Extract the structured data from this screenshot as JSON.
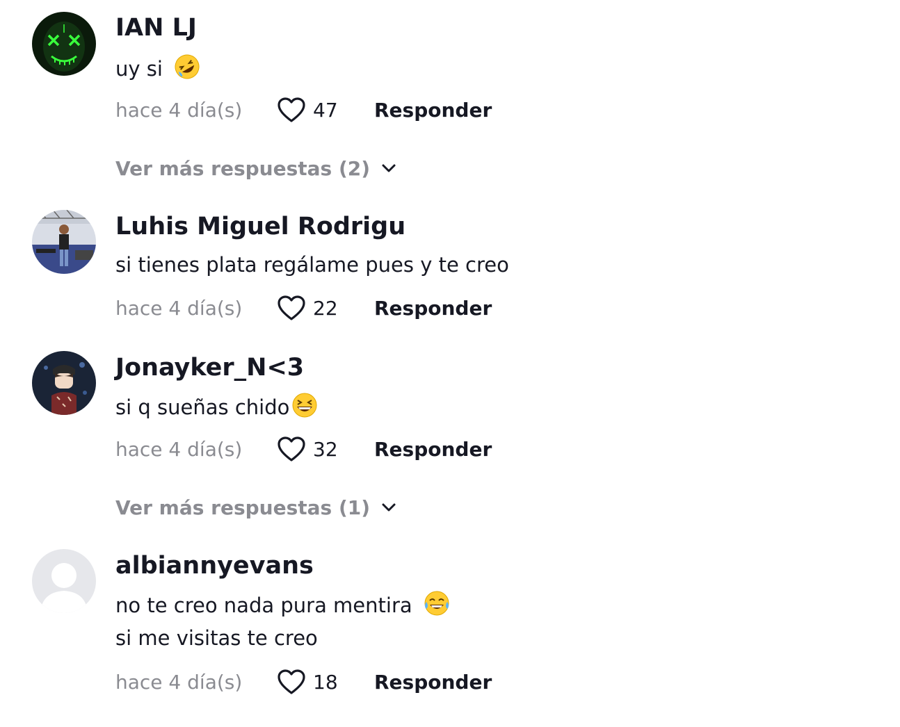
{
  "comments": [
    {
      "username": "IAN LJ",
      "lines": [
        "uy si"
      ],
      "emoji": "rolling-on-floor-laughing",
      "time": "hace 4 día(s)",
      "likes": "47",
      "reply_label": "Responder",
      "more_replies": "Ver más respuestas (2)"
    },
    {
      "username": "Luhis Miguel Rodrigu",
      "lines": [
        "si tienes plata regálame pues y te creo"
      ],
      "time": "hace 4 día(s)",
      "likes": "22",
      "reply_label": "Responder"
    },
    {
      "username": "Jonayker_N<3",
      "lines": [
        "si q sueñas chido"
      ],
      "emoji": "grinning-squinting-face",
      "time": "hace 4 día(s)",
      "likes": "32",
      "reply_label": "Responder",
      "more_replies": "Ver más respuestas (1)"
    },
    {
      "username": "albiannyevans",
      "lines": [
        "no te creo nada pura mentira",
        "si me visitas te creo"
      ],
      "emoji": "face-with-tears-of-joy",
      "time": "hace 4 día(s)",
      "likes": "18",
      "reply_label": "Responder"
    }
  ],
  "colors": {
    "text": "#161823",
    "muted": "#8a8b91",
    "background": "#ffffff"
  }
}
